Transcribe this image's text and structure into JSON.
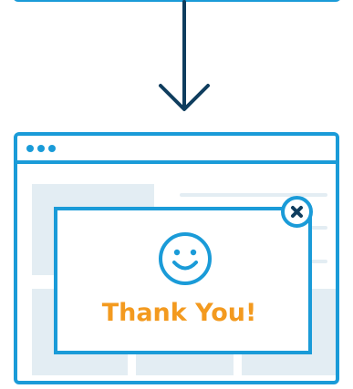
{
  "modal": {
    "message": "Thank You!"
  },
  "colors": {
    "frame": "#1a9bd8",
    "arrow": "#0f3d5e",
    "accent": "#f39a1f",
    "placeholder": "#e3edf3",
    "background": "#ffffff"
  },
  "icons": {
    "flow_arrow": "arrow-down-icon",
    "smile": "smile-icon",
    "close": "close-icon"
  }
}
